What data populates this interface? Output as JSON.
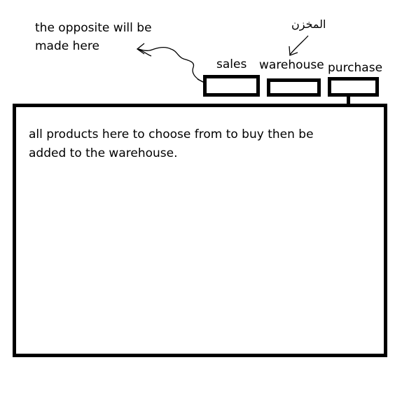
{
  "annotations": {
    "opposite_note_line1": "the opposite will be",
    "opposite_note_line2": "made here",
    "warehouse_arabic": "المخزن"
  },
  "tabs": [
    {
      "label": "sales"
    },
    {
      "label": "warehouse"
    },
    {
      "label": "purchase"
    }
  ],
  "main_panel": {
    "text_line1": "all products here to choose from to buy then be",
    "text_line2": "added to the warehouse."
  }
}
